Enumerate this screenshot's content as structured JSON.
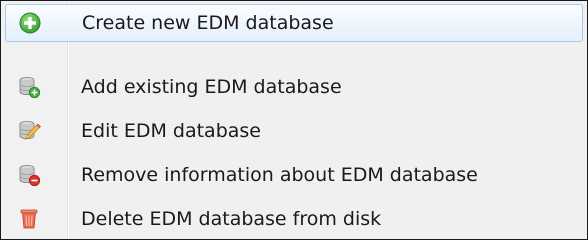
{
  "menu": {
    "items": [
      {
        "label": "Create new EDM database",
        "icon": "add-circle-icon",
        "highlighted": true
      },
      {
        "label": "Add existing EDM database",
        "icon": "database-add-icon",
        "highlighted": false
      },
      {
        "label": "Edit EDM database",
        "icon": "database-edit-icon",
        "highlighted": false
      },
      {
        "label": "Remove information about EDM database",
        "icon": "database-remove-icon",
        "highlighted": false
      },
      {
        "label": "Delete EDM database from disk",
        "icon": "trash-icon",
        "highlighted": false
      }
    ]
  },
  "colors": {
    "add_green": "#3fae3f",
    "remove_red": "#d9352b",
    "trash_red": "#e8533f",
    "highlight_border": "#a8c8ee"
  }
}
